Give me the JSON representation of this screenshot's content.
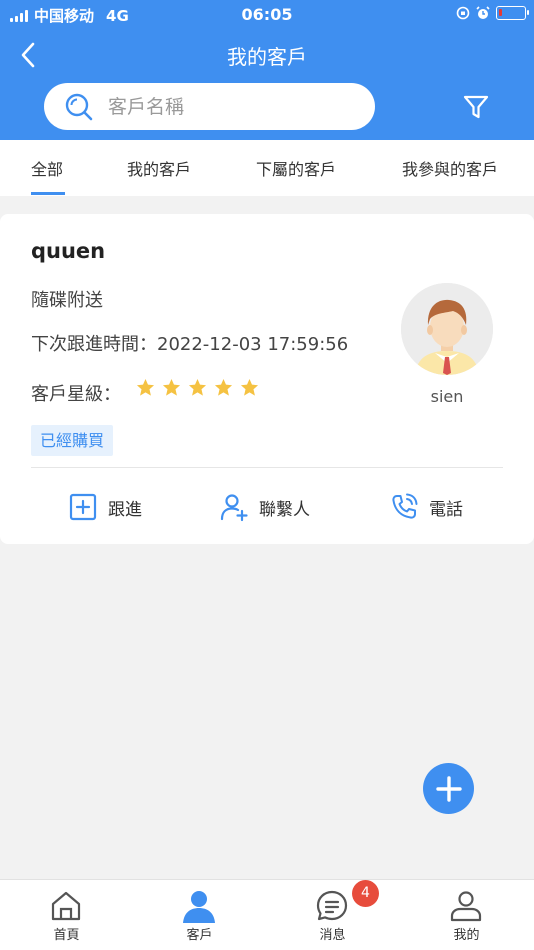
{
  "status_bar": {
    "carrier": "中国移动",
    "network": "4G",
    "time": "06:05"
  },
  "nav": {
    "title": "我的客戶"
  },
  "search": {
    "placeholder": "客戶名稱"
  },
  "tabs": [
    {
      "label": "全部",
      "active": true
    },
    {
      "label": "我的客戶",
      "active": false
    },
    {
      "label": "下屬的客戶",
      "active": false
    },
    {
      "label": "我參與的客戶",
      "active": false
    }
  ],
  "customer": {
    "name": "quuen",
    "note": "隨碟附送",
    "next_followup_label": "下次跟進時間：",
    "next_followup": "2022-12-03 17:59:56",
    "rating_label": "客戶星級：",
    "rating": 5,
    "status_badge": "已經購買",
    "owner_name": "sien",
    "actions": [
      {
        "label": "跟進",
        "icon": "add-square-icon"
      },
      {
        "label": "聯繫人",
        "icon": "add-user-icon"
      },
      {
        "label": "電話",
        "icon": "phone-icon"
      }
    ]
  },
  "bottom_nav": [
    {
      "label": "首頁",
      "icon": "home-icon",
      "active": false
    },
    {
      "label": "客戶",
      "icon": "customer-icon",
      "active": true
    },
    {
      "label": "消息",
      "icon": "message-icon",
      "active": false,
      "badge": "4"
    },
    {
      "label": "我的",
      "icon": "profile-icon",
      "active": false
    }
  ],
  "colors": {
    "primary": "#3f8ff0",
    "star": "#f5c242",
    "badge_red": "#e74c3c",
    "background": "#f2f2f2"
  }
}
